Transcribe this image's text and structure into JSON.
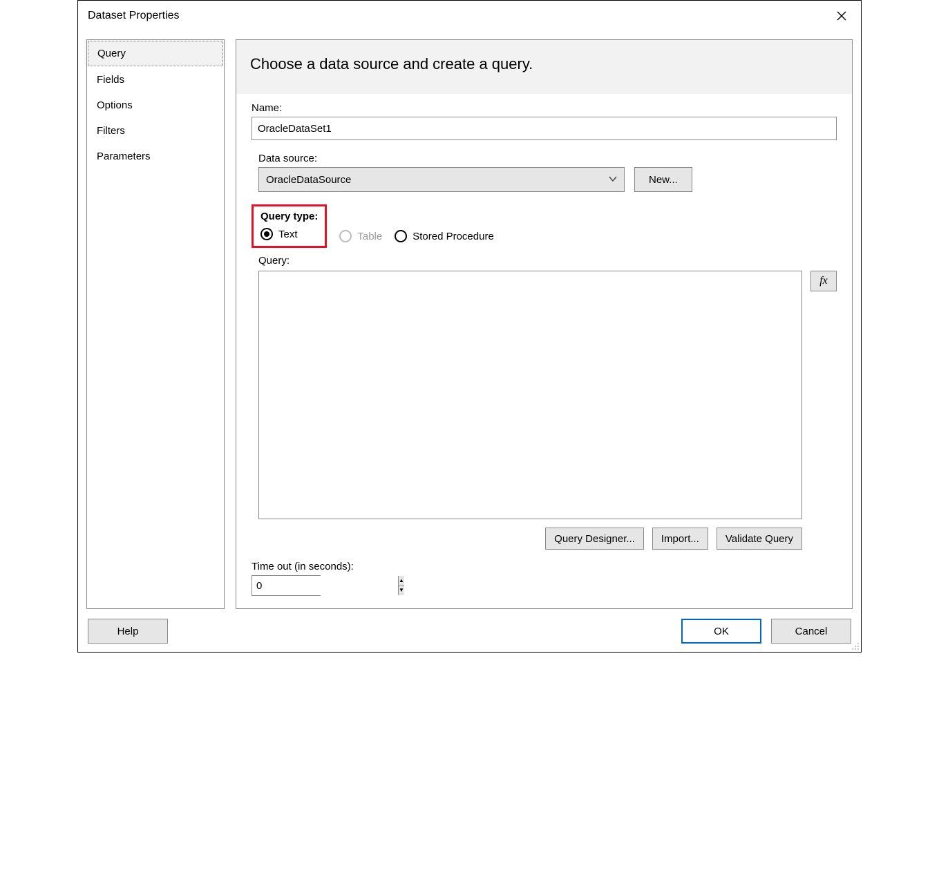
{
  "window": {
    "title": "Dataset Properties"
  },
  "sidebar": {
    "items": [
      {
        "label": "Query",
        "selected": true
      },
      {
        "label": "Fields",
        "selected": false
      },
      {
        "label": "Options",
        "selected": false
      },
      {
        "label": "Filters",
        "selected": false
      },
      {
        "label": "Parameters",
        "selected": false
      }
    ]
  },
  "panel": {
    "heading": "Choose a data source and create a query.",
    "name_label": "Name:",
    "name_value": "OracleDataSet1",
    "datasource_label": "Data source:",
    "datasource_value": "OracleDataSource",
    "new_button": "New...",
    "query_type_label": "Query type:",
    "query_type": {
      "text": "Text",
      "table": "Table",
      "stored_procedure": "Stored Procedure"
    },
    "query_label": "Query:",
    "query_value": "",
    "fx_label": "fx",
    "query_designer_button": "Query Designer...",
    "import_button": "Import...",
    "validate_button": "Validate Query",
    "timeout_label": "Time out (in seconds):",
    "timeout_value": "0"
  },
  "footer": {
    "help": "Help",
    "ok": "OK",
    "cancel": "Cancel"
  }
}
